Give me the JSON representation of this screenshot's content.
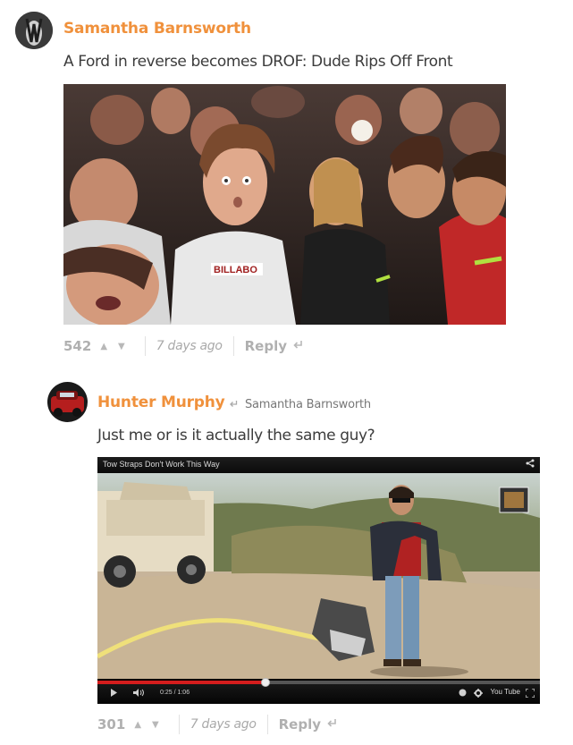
{
  "comments": [
    {
      "author": "Samantha Barnsworth",
      "text": "A Ford in reverse becomes DROF: Dude Rips Off Front",
      "likes": "542",
      "time": "7 days ago",
      "reply_label": "Reply"
    },
    {
      "author": "Hunter Murphy",
      "reply_to": "Samantha Barnsworth",
      "text": "Just me or is it actually the same guy?",
      "likes": "301",
      "time": "7 days ago",
      "reply_label": "Reply",
      "video": {
        "title": "Tow Straps Don't Work This Way",
        "time_current": "0:25",
        "time_total": "1:06",
        "progress": 0.38,
        "brand": "You Tube"
      }
    }
  ],
  "icons": {
    "upvote": "▲",
    "downvote": "▼",
    "reply": "reply-arrow-icon"
  },
  "colors": {
    "author": "#f0913c",
    "meta": "#b0b0b0",
    "progress": "#d41d1d"
  }
}
